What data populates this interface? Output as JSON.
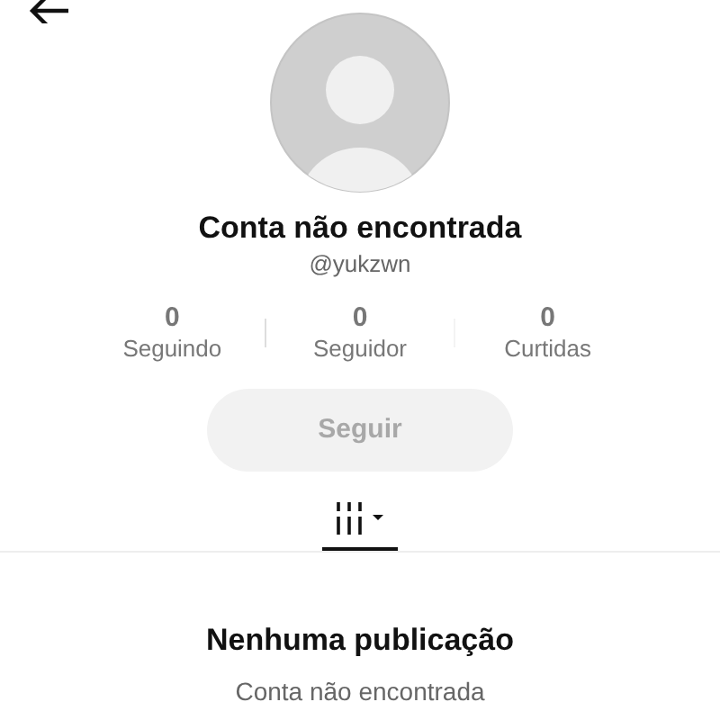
{
  "profile": {
    "name": "Conta não encontrada",
    "username": "@yukzwn"
  },
  "stats": [
    {
      "value": "0",
      "label": "Seguindo"
    },
    {
      "value": "0",
      "label": "Seguidor"
    },
    {
      "value": "0",
      "label": "Curtidas"
    }
  ],
  "follow_button": {
    "label": "Seguir",
    "disabled": true
  },
  "tabs": [
    {
      "kind": "grid",
      "selected": true
    }
  ],
  "empty_state": {
    "title": "Nenhuma publicação",
    "subtitle": "Conta não encontrada"
  }
}
